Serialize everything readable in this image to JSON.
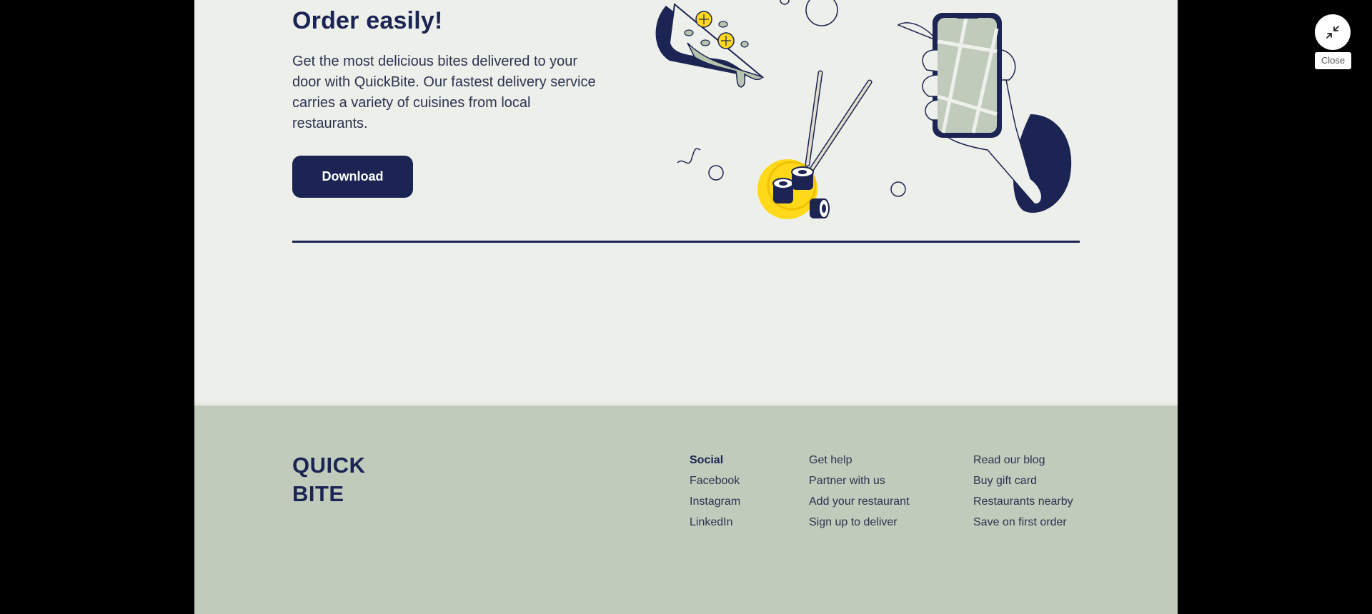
{
  "hero": {
    "title": "Order easily!",
    "description": "Get the most delicious bites delivered to your door with QuickBite. Our fastest delivery service carries a variety of cuisines from local restaurants.",
    "button_label": "Download"
  },
  "footer": {
    "brand_line1": "QUICK",
    "brand_line2": "BITE",
    "social": {
      "heading": "Social",
      "links": [
        "Facebook",
        "Instagram",
        "LinkedIn"
      ]
    },
    "help_links": [
      "Get help",
      "Partner with us",
      "Add your restaurant",
      "Sign up to deliver"
    ],
    "more_links": [
      "Read our blog",
      "Buy gift card",
      "Restaurants nearby",
      "Save on first order"
    ]
  },
  "overlay": {
    "close_label": "Close",
    "close_icon": "collapse-arrows-icon"
  },
  "colors": {
    "navy": "#1b2452",
    "page_bg": "#edefea",
    "footer_bg": "#c0cbbb",
    "accent_yellow": "#ffd91a"
  }
}
